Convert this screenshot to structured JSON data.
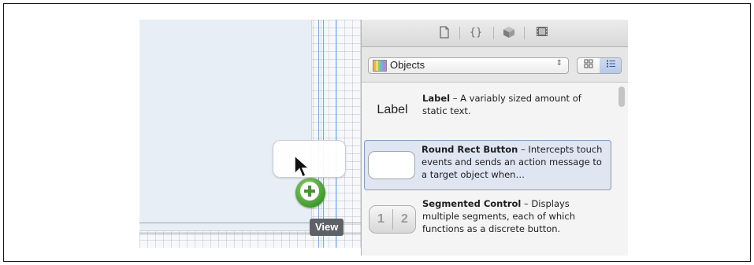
{
  "library": {
    "toolbar": {
      "icons": [
        "file-icon",
        "braces-icon",
        "cube-icon",
        "film-icon"
      ],
      "braces_glyph": "{}"
    },
    "filter": {
      "popup_label": "Objects",
      "view_modes": [
        "grid-view-icon",
        "list-view-icon"
      ],
      "active_mode": "list-view-icon"
    },
    "items": [
      {
        "thumb_text": "Label",
        "name": "Label",
        "description": " – A variably sized amount of static text."
      },
      {
        "thumb_text": "",
        "name": "Round Rect Button",
        "description": " – Intercepts touch events and sends an action message to a target object when…",
        "selected": true
      },
      {
        "thumb_seg_1": "1",
        "thumb_seg_2": "2",
        "name": "Segmented Control",
        "description": " – Displays multiple segments, each of which functions as a discrete button."
      }
    ]
  },
  "canvas": {
    "tooltip": "View"
  },
  "colors": {
    "selection_accent": "#7e9ccd",
    "add_badge": "#3f9a2b"
  }
}
